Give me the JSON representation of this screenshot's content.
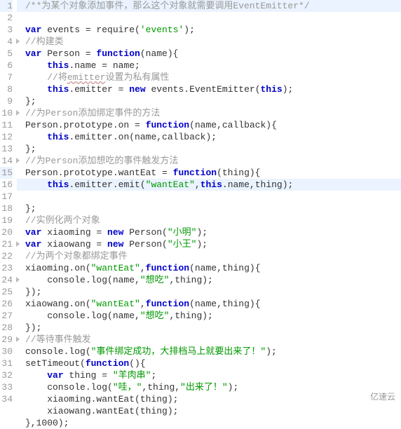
{
  "lines": [
    {
      "n": 1,
      "fold": false,
      "hl": true,
      "html": "<span class='cmt'>/**为某个对象添加事件，那么这个对象就需要调用EventEmitter*/</span>"
    },
    {
      "n": 2,
      "fold": false,
      "hl": false,
      "html": "<span class='kw'>var</span> events = require(<span class='str'>'events'</span>);"
    },
    {
      "n": 3,
      "fold": false,
      "hl": false,
      "html": "<span class='cmt'>//构建类</span>"
    },
    {
      "n": 4,
      "fold": true,
      "hl": false,
      "html": "<span class='kw'>var</span> Person = <span class='kw'>function</span>(name){"
    },
    {
      "n": 5,
      "fold": false,
      "hl": false,
      "html": "    <span class='kw'>this</span>.name = name;"
    },
    {
      "n": 6,
      "fold": false,
      "hl": false,
      "html": "    <span class='cmt'>//将<span class='ul'>emitter</span>设置为私有属性</span>"
    },
    {
      "n": 7,
      "fold": false,
      "hl": false,
      "html": "    <span class='kw'>this</span>.emitter = <span class='kw'>new</span> events.EventEmitter(<span class='kw'>this</span>);"
    },
    {
      "n": 8,
      "fold": false,
      "hl": false,
      "html": "};"
    },
    {
      "n": 9,
      "fold": false,
      "hl": false,
      "html": "<span class='cmt'>//为Person添加绑定事件的方法</span>"
    },
    {
      "n": 10,
      "fold": true,
      "hl": false,
      "html": "Person.prototype.on = <span class='kw'>function</span>(name,callback){"
    },
    {
      "n": 11,
      "fold": false,
      "hl": false,
      "html": "    <span class='kw'>this</span>.emitter.on(name,callback);"
    },
    {
      "n": 12,
      "fold": false,
      "hl": false,
      "html": "};"
    },
    {
      "n": 13,
      "fold": false,
      "hl": false,
      "html": "<span class='cmt'>//为Person添加想吃的事件触发方法</span>"
    },
    {
      "n": 14,
      "fold": true,
      "hl": false,
      "html": "Person.prototype.wantEat = <span class='kw'>function</span>(thing){"
    },
    {
      "n": 15,
      "fold": false,
      "hl": true,
      "html": "    <span class='kw'>this</span>.emitter.emit(<span class='str'>\"wantEat\"</span>,<span class='kw'>this</span>.name,thing);"
    },
    {
      "n": 16,
      "fold": false,
      "hl": false,
      "html": "};"
    },
    {
      "n": 17,
      "fold": false,
      "hl": false,
      "html": "<span class='cmt'>//实例化两个对象</span>"
    },
    {
      "n": 18,
      "fold": false,
      "hl": false,
      "html": "<span class='kw'>var</span> xiaoming = <span class='kw'>new</span> Person(<span class='str'>\"小明\"</span>);"
    },
    {
      "n": 19,
      "fold": false,
      "hl": false,
      "html": "<span class='kw'>var</span> xiaowang = <span class='kw'>new</span> Person(<span class='str'>\"小王\"</span>);"
    },
    {
      "n": 20,
      "fold": false,
      "hl": false,
      "html": "<span class='cmt'>//为两个对象都绑定事件</span>"
    },
    {
      "n": 21,
      "fold": true,
      "hl": false,
      "html": "xiaoming.on(<span class='str'>\"wantEat\"</span>,<span class='kw'>function</span>(name,thing){"
    },
    {
      "n": 22,
      "fold": false,
      "hl": false,
      "html": "    console.log(name,<span class='str'>\"想吃\"</span>,thing);"
    },
    {
      "n": 23,
      "fold": false,
      "hl": false,
      "html": "});"
    },
    {
      "n": 24,
      "fold": true,
      "hl": false,
      "html": "xiaowang.on(<span class='str'>\"wantEat\"</span>,<span class='kw'>function</span>(name,thing){"
    },
    {
      "n": 25,
      "fold": false,
      "hl": false,
      "html": "    console.log(name,<span class='str'>\"想吃\"</span>,thing);"
    },
    {
      "n": 26,
      "fold": false,
      "hl": false,
      "html": "});"
    },
    {
      "n": 27,
      "fold": false,
      "hl": false,
      "html": "<span class='cmt'>//等待事件触发</span>"
    },
    {
      "n": 28,
      "fold": false,
      "hl": false,
      "html": "console.log(<span class='str'>\"事件绑定成功，大排档马上就要出来了！\"</span>);"
    },
    {
      "n": 29,
      "fold": true,
      "hl": false,
      "html": "setTimeout(<span class='kw'>function</span>(){"
    },
    {
      "n": 30,
      "fold": false,
      "hl": false,
      "html": "    <span class='kw'>var</span> thing = <span class='str'>\"羊肉串\"</span>;"
    },
    {
      "n": 31,
      "fold": false,
      "hl": false,
      "html": "    console.log(<span class='str'>\"哇，\"</span>,thing,<span class='str'>\"出来了！\"</span>);"
    },
    {
      "n": 32,
      "fold": false,
      "hl": false,
      "html": "    xiaoming.wantEat(thing);"
    },
    {
      "n": 33,
      "fold": false,
      "hl": false,
      "html": "    xiaowang.wantEat(thing);"
    },
    {
      "n": 34,
      "fold": false,
      "hl": false,
      "html": "},1000);"
    }
  ],
  "watermark": "亿速云"
}
